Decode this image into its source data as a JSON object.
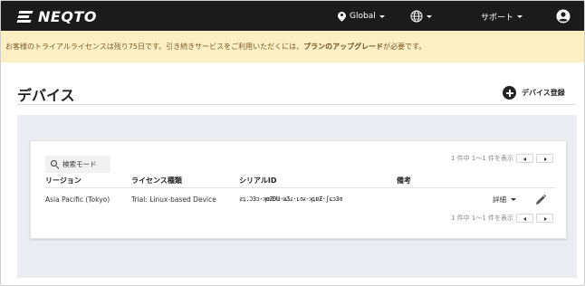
{
  "app": {
    "logo_text": "NEQTO"
  },
  "nav": {
    "region_label": "Global",
    "language_icon": "globe-icon",
    "support_label": "サポート",
    "user_icon": "user-circle-icon"
  },
  "banner": {
    "text_prefix": "お客様のトライアルライセンスは残り75日です。引き続きサービスをご利用いただくには、",
    "text_bold": "プランのアップグレード",
    "text_suffix": "が必要です。"
  },
  "page": {
    "title": "デバイス",
    "add_button_label": "デバイス登録"
  },
  "table": {
    "search_mode_label": "検索モード",
    "pager_top_text": "1 件中 1〜1 件を表示",
    "pager_bottom_text": "1 件中 1〜1 件を表示",
    "columns": [
      "リージョン",
      "ライセンス種類",
      "シリアルID",
      "備考"
    ],
    "rows": [
      {
        "region": "Asia Pacific (Tokyo)",
        "license": "Trial: Linux-based Device",
        "serial_id": "ƨʇ.Ɔ3ɔ·ʞɶƵƉƜ·ɯƷɾ·ʟɞᵶ·ʞʇɐƵ·ʃɕɔ3ɞ",
        "note": "",
        "detail_label": "詳細"
      }
    ]
  },
  "colors": {
    "nav_bg": "#1b1b1b",
    "banner_bg": "#fcefc3",
    "banner_text": "#7a5b2c",
    "content_bg": "#eaeef3"
  }
}
